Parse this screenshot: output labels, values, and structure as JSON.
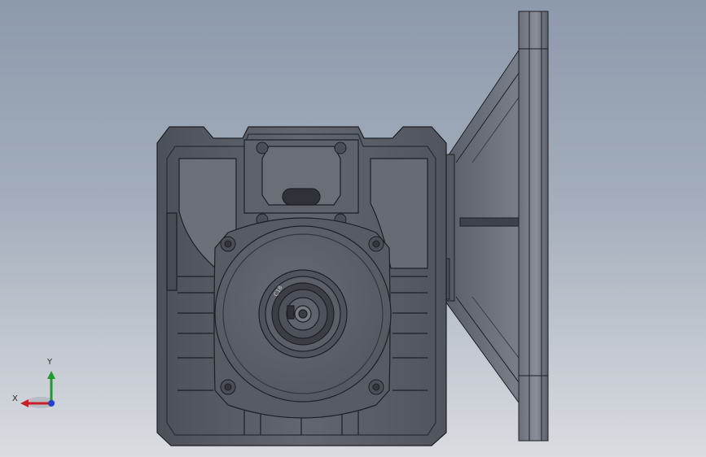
{
  "viewport": {
    "background_top": "#8d9aac",
    "background_bottom": "#d9dce1"
  },
  "model": {
    "body_color": "#5b5f69",
    "edge_color": "#1d1f24",
    "shaft_marking": "C18"
  },
  "triad": {
    "x_label": "X",
    "y_label": "Y",
    "x_color": "#c8202a",
    "y_color": "#1f9a2e",
    "z_color": "#2442c8"
  }
}
